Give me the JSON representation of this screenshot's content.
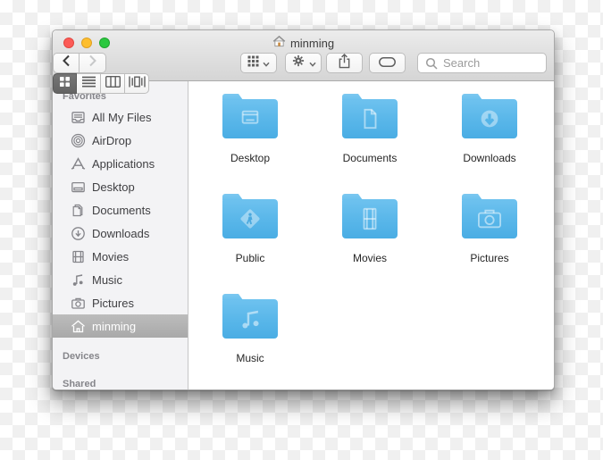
{
  "window": {
    "title": "minming"
  },
  "toolbar": {
    "search_placeholder": "Search"
  },
  "sidebar": {
    "favorites_header": "Favorites",
    "devices_header": "Devices",
    "shared_header": "Shared",
    "favorites": [
      {
        "label": "All My Files",
        "icon": "all-my-files-icon"
      },
      {
        "label": "AirDrop",
        "icon": "airdrop-icon"
      },
      {
        "label": "Applications",
        "icon": "applications-icon"
      },
      {
        "label": "Desktop",
        "icon": "desktop-icon"
      },
      {
        "label": "Documents",
        "icon": "documents-icon"
      },
      {
        "label": "Downloads",
        "icon": "downloads-icon"
      },
      {
        "label": "Movies",
        "icon": "movies-icon"
      },
      {
        "label": "Music",
        "icon": "music-icon"
      },
      {
        "label": "Pictures",
        "icon": "pictures-icon"
      },
      {
        "label": "minming",
        "icon": "home-icon",
        "selected": true
      }
    ]
  },
  "content": {
    "folders": [
      {
        "name": "Desktop",
        "icon": "desktop-folder-glyph"
      },
      {
        "name": "Documents",
        "icon": "documents-folder-glyph"
      },
      {
        "name": "Downloads",
        "icon": "downloads-folder-glyph"
      },
      {
        "name": "Public",
        "icon": "public-folder-glyph"
      },
      {
        "name": "Movies",
        "icon": "movies-folder-glyph"
      },
      {
        "name": "Pictures",
        "icon": "pictures-folder-glyph"
      },
      {
        "name": "Music",
        "icon": "music-folder-glyph"
      }
    ]
  },
  "colors": {
    "folder_blue": "#55b3e7",
    "sidebar_selection": "#b2b2b2",
    "traffic_red": "#fc5b57",
    "traffic_yellow": "#fdbe2e",
    "traffic_green": "#2bc840"
  }
}
